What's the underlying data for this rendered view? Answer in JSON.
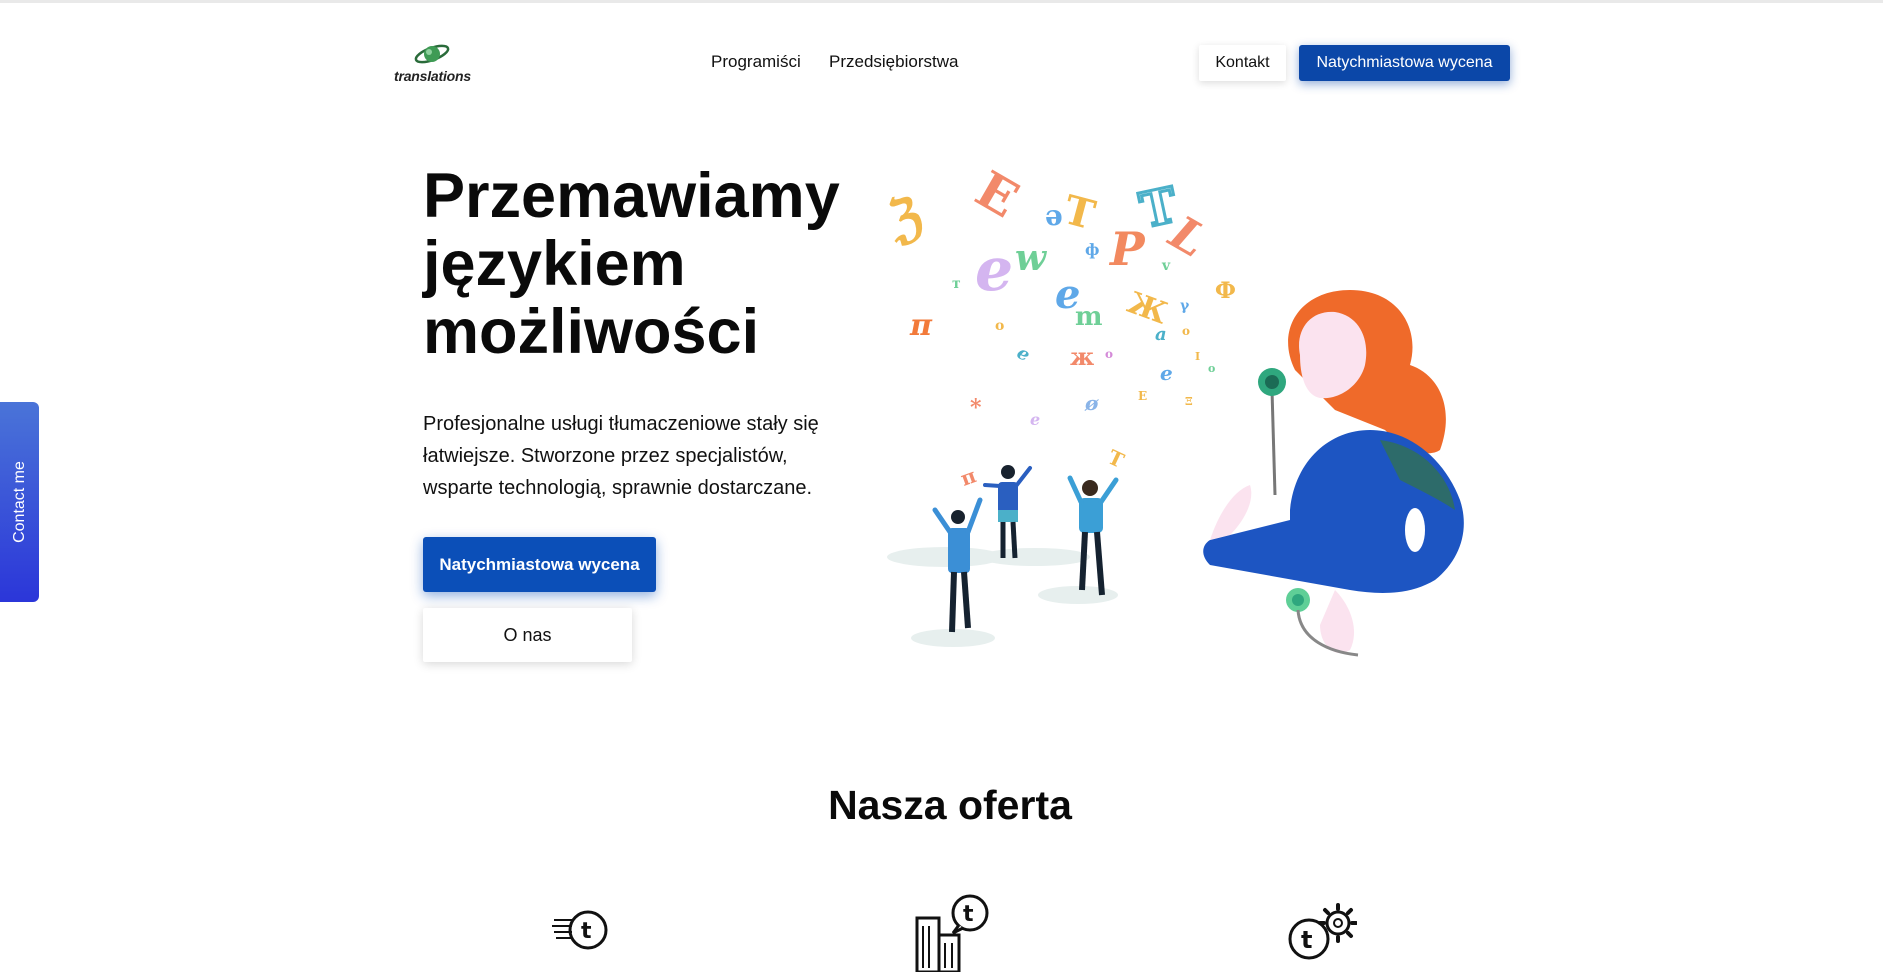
{
  "header": {
    "logo_text": "translations",
    "nav": [
      "Programiści",
      "Przedsiębiorstwa"
    ],
    "contact_label": "Kontakt",
    "quote_label": "Natychmiastowa wycena"
  },
  "side_tab": {
    "label": "Contact me"
  },
  "hero": {
    "title_lines": [
      "Przemawiamy",
      "językiem",
      "możliwości"
    ],
    "subtitle": "Profesjonalne usługi tłumaczeniowe stały się łatwiejsze. Stworzone przez specjalistów, wsparte technologią, sprawnie dostarczane.",
    "primary_button": "Natychmiastowa wycena",
    "secondary_button": "O nas"
  },
  "offer": {
    "title": "Nasza oferta",
    "icons": [
      "fast-translation-icon",
      "business-translation-icon",
      "tech-translation-icon"
    ]
  },
  "colors": {
    "brand_blue": "#0b47a8",
    "contact_tab": "#2b36d9",
    "hair_orange": "#ef6a2a",
    "shirt_blue": "#1d55c2"
  }
}
